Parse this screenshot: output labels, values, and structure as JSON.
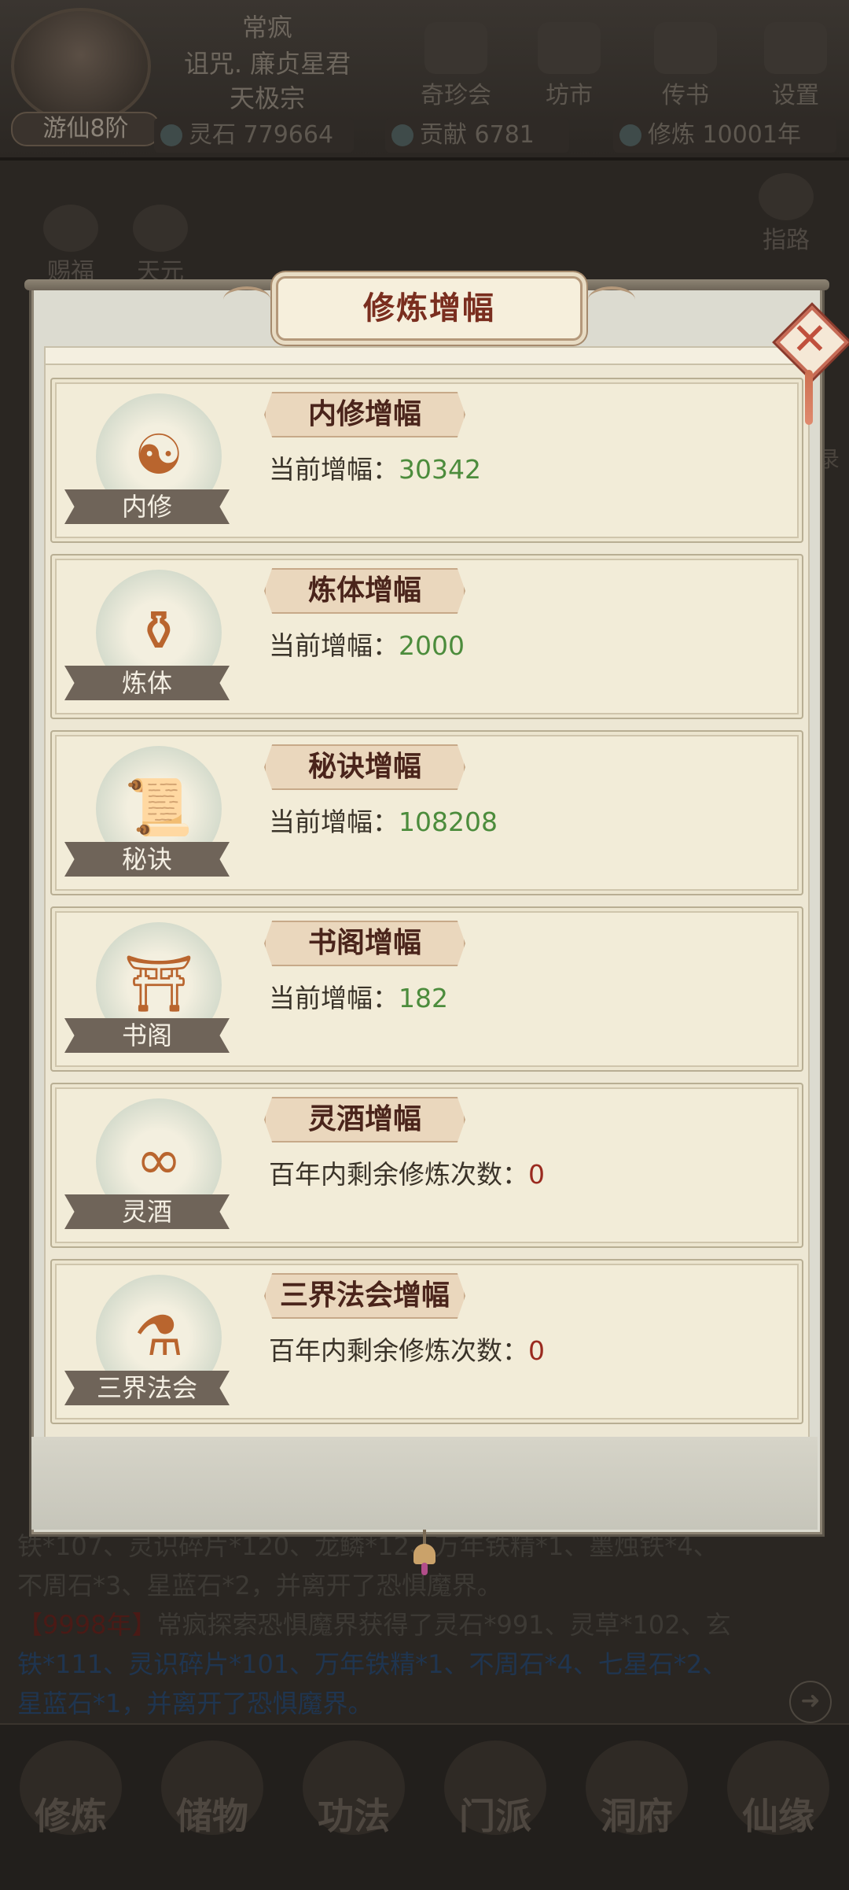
{
  "header": {
    "player_name": "常疯",
    "player_title": "诅咒. 廉贞星君",
    "sect": "天极宗",
    "rank": "游仙8阶",
    "resources": [
      {
        "label": "灵石",
        "value": "779664"
      },
      {
        "label": "贡献",
        "value": "6781"
      },
      {
        "label": "修炼",
        "value": "10001年"
      }
    ],
    "buttons": [
      "奇珍会",
      "坊市",
      "传书",
      "设置"
    ]
  },
  "side": {
    "left_buttons": [
      "赐福",
      "天元"
    ],
    "right_button": "指路",
    "right_edge_label": "录"
  },
  "log": {
    "line1": "铁*107、灵识碎片*120、龙鳞*12、万年铁精*1、墨烛铁*4、",
    "line2": "不周石*3、星蓝石*2，并离开了恐惧魔界。",
    "line3_year": "【9998年】",
    "line3_text": "常疯探索恐惧魔界获得了灵石*991、灵草*102、玄",
    "line4": "铁*111、灵识碎片*101、万年铁精*1、不周石*4、七星石*2、",
    "line5": "星蓝石*1，并离开了恐惧魔界。",
    "arrow": "➜"
  },
  "nav": [
    "修炼",
    "储物",
    "功法",
    "门派",
    "洞府",
    "仙缘"
  ],
  "modal": {
    "title": "修炼增幅",
    "close": "✕",
    "cards": [
      {
        "icon_label": "内修",
        "title": "内修增幅",
        "label": "当前增幅：",
        "value": "30342",
        "glyph": "☯"
      },
      {
        "icon_label": "炼体",
        "title": "炼体增幅",
        "label": "当前增幅：",
        "value": "2000",
        "glyph": "⚱"
      },
      {
        "icon_label": "秘诀",
        "title": "秘诀增幅",
        "label": "当前增幅：",
        "value": "108208",
        "glyph": "📜"
      },
      {
        "icon_label": "书阁",
        "title": "书阁增幅",
        "label": "当前增幅：",
        "value": "182",
        "glyph": "⛩"
      },
      {
        "icon_label": "灵酒",
        "title": "灵酒增幅",
        "label": "百年内剩余修炼次数：",
        "value": "0",
        "glyph": "∞"
      },
      {
        "icon_label": "三界法会",
        "title": "三界法会增幅",
        "label": "百年内剩余修炼次数：",
        "value": "0",
        "glyph": "⚗"
      }
    ]
  },
  "colors": {
    "value_green": "#4c8c3c",
    "value_red": "#9a2a1f",
    "title_red": "#7a2e1f"
  }
}
